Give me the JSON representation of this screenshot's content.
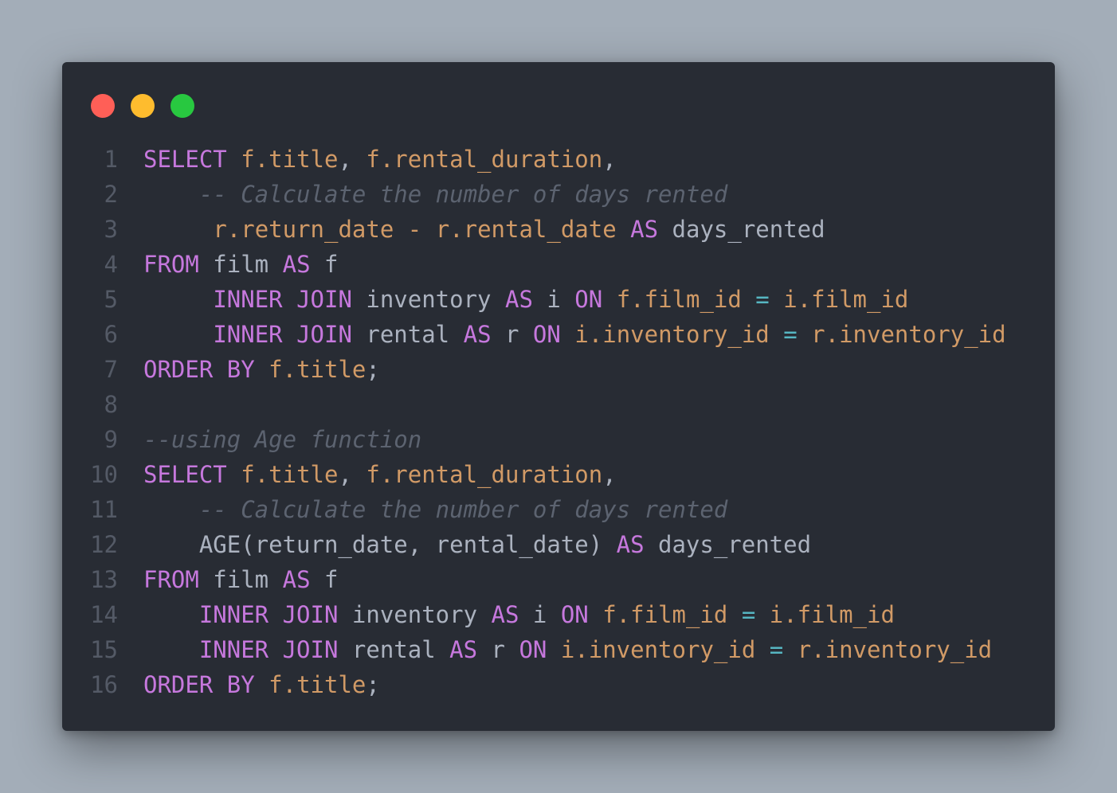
{
  "window": {
    "traffic_lights": {
      "close_color": "#ff5f57",
      "minimize_color": "#febc2e",
      "maximize_color": "#28c840"
    }
  },
  "editor": {
    "language": "sql",
    "lines": [
      {
        "number": "1",
        "tokens": [
          {
            "t": "kw",
            "v": "SELECT"
          },
          {
            "t": "plain",
            "v": " "
          },
          {
            "t": "id",
            "v": "f.title"
          },
          {
            "t": "plain",
            "v": ", "
          },
          {
            "t": "id",
            "v": "f.rental_duration"
          },
          {
            "t": "plain",
            "v": ","
          }
        ]
      },
      {
        "number": "2",
        "tokens": [
          {
            "t": "plain",
            "v": "    "
          },
          {
            "t": "cm",
            "v": "-- Calculate the number of days rented"
          }
        ]
      },
      {
        "number": "3",
        "tokens": [
          {
            "t": "plain",
            "v": "     "
          },
          {
            "t": "id",
            "v": "r.return_date"
          },
          {
            "t": "plain",
            "v": " "
          },
          {
            "t": "id",
            "v": "-"
          },
          {
            "t": "plain",
            "v": " "
          },
          {
            "t": "id",
            "v": "r.rental_date"
          },
          {
            "t": "plain",
            "v": " "
          },
          {
            "t": "kw",
            "v": "AS"
          },
          {
            "t": "plain",
            "v": " days_rented"
          }
        ]
      },
      {
        "number": "4",
        "tokens": [
          {
            "t": "kw",
            "v": "FROM"
          },
          {
            "t": "plain",
            "v": " film "
          },
          {
            "t": "kw",
            "v": "AS"
          },
          {
            "t": "plain",
            "v": " f"
          }
        ]
      },
      {
        "number": "5",
        "tokens": [
          {
            "t": "plain",
            "v": "     "
          },
          {
            "t": "kw",
            "v": "INNER JOIN"
          },
          {
            "t": "plain",
            "v": " inventory "
          },
          {
            "t": "kw",
            "v": "AS"
          },
          {
            "t": "plain",
            "v": " i "
          },
          {
            "t": "kw",
            "v": "ON"
          },
          {
            "t": "plain",
            "v": " "
          },
          {
            "t": "id",
            "v": "f.film_id"
          },
          {
            "t": "plain",
            "v": " "
          },
          {
            "t": "op",
            "v": "="
          },
          {
            "t": "plain",
            "v": " "
          },
          {
            "t": "id",
            "v": "i.film_id"
          }
        ]
      },
      {
        "number": "6",
        "tokens": [
          {
            "t": "plain",
            "v": "     "
          },
          {
            "t": "kw",
            "v": "INNER JOIN"
          },
          {
            "t": "plain",
            "v": " rental "
          },
          {
            "t": "kw",
            "v": "AS"
          },
          {
            "t": "plain",
            "v": " r "
          },
          {
            "t": "kw",
            "v": "ON"
          },
          {
            "t": "plain",
            "v": " "
          },
          {
            "t": "id",
            "v": "i.inventory_id"
          },
          {
            "t": "plain",
            "v": " "
          },
          {
            "t": "op",
            "v": "="
          },
          {
            "t": "plain",
            "v": " "
          },
          {
            "t": "id",
            "v": "r.inventory_id"
          }
        ]
      },
      {
        "number": "7",
        "tokens": [
          {
            "t": "kw",
            "v": "ORDER BY"
          },
          {
            "t": "plain",
            "v": " "
          },
          {
            "t": "id",
            "v": "f.title"
          },
          {
            "t": "plain",
            "v": ";"
          }
        ]
      },
      {
        "number": "8",
        "tokens": []
      },
      {
        "number": "9",
        "tokens": [
          {
            "t": "cm",
            "v": "--using Age function"
          }
        ]
      },
      {
        "number": "10",
        "tokens": [
          {
            "t": "kw",
            "v": "SELECT"
          },
          {
            "t": "plain",
            "v": " "
          },
          {
            "t": "id",
            "v": "f.title"
          },
          {
            "t": "plain",
            "v": ", "
          },
          {
            "t": "id",
            "v": "f.rental_duration"
          },
          {
            "t": "plain",
            "v": ","
          }
        ]
      },
      {
        "number": "11",
        "tokens": [
          {
            "t": "plain",
            "v": "    "
          },
          {
            "t": "cm",
            "v": "-- Calculate the number of days rented"
          }
        ]
      },
      {
        "number": "12",
        "tokens": [
          {
            "t": "plain",
            "v": "    AGE(return_date, rental_date) "
          },
          {
            "t": "kw",
            "v": "AS"
          },
          {
            "t": "plain",
            "v": " days_rented"
          }
        ]
      },
      {
        "number": "13",
        "tokens": [
          {
            "t": "kw",
            "v": "FROM"
          },
          {
            "t": "plain",
            "v": " film "
          },
          {
            "t": "kw",
            "v": "AS"
          },
          {
            "t": "plain",
            "v": " f"
          }
        ]
      },
      {
        "number": "14",
        "tokens": [
          {
            "t": "plain",
            "v": "    "
          },
          {
            "t": "kw",
            "v": "INNER JOIN"
          },
          {
            "t": "plain",
            "v": " inventory "
          },
          {
            "t": "kw",
            "v": "AS"
          },
          {
            "t": "plain",
            "v": " i "
          },
          {
            "t": "kw",
            "v": "ON"
          },
          {
            "t": "plain",
            "v": " "
          },
          {
            "t": "id",
            "v": "f.film_id"
          },
          {
            "t": "plain",
            "v": " "
          },
          {
            "t": "op",
            "v": "="
          },
          {
            "t": "plain",
            "v": " "
          },
          {
            "t": "id",
            "v": "i.film_id"
          }
        ]
      },
      {
        "number": "15",
        "tokens": [
          {
            "t": "plain",
            "v": "    "
          },
          {
            "t": "kw",
            "v": "INNER JOIN"
          },
          {
            "t": "plain",
            "v": " rental "
          },
          {
            "t": "kw",
            "v": "AS"
          },
          {
            "t": "plain",
            "v": " r "
          },
          {
            "t": "kw",
            "v": "ON"
          },
          {
            "t": "plain",
            "v": " "
          },
          {
            "t": "id",
            "v": "i.inventory_id"
          },
          {
            "t": "plain",
            "v": " "
          },
          {
            "t": "op",
            "v": "="
          },
          {
            "t": "plain",
            "v": " "
          },
          {
            "t": "id",
            "v": "r.inventory_id"
          }
        ]
      },
      {
        "number": "16",
        "tokens": [
          {
            "t": "kw",
            "v": "ORDER BY"
          },
          {
            "t": "plain",
            "v": " "
          },
          {
            "t": "id",
            "v": "f.title"
          },
          {
            "t": "plain",
            "v": ";"
          }
        ]
      }
    ]
  }
}
